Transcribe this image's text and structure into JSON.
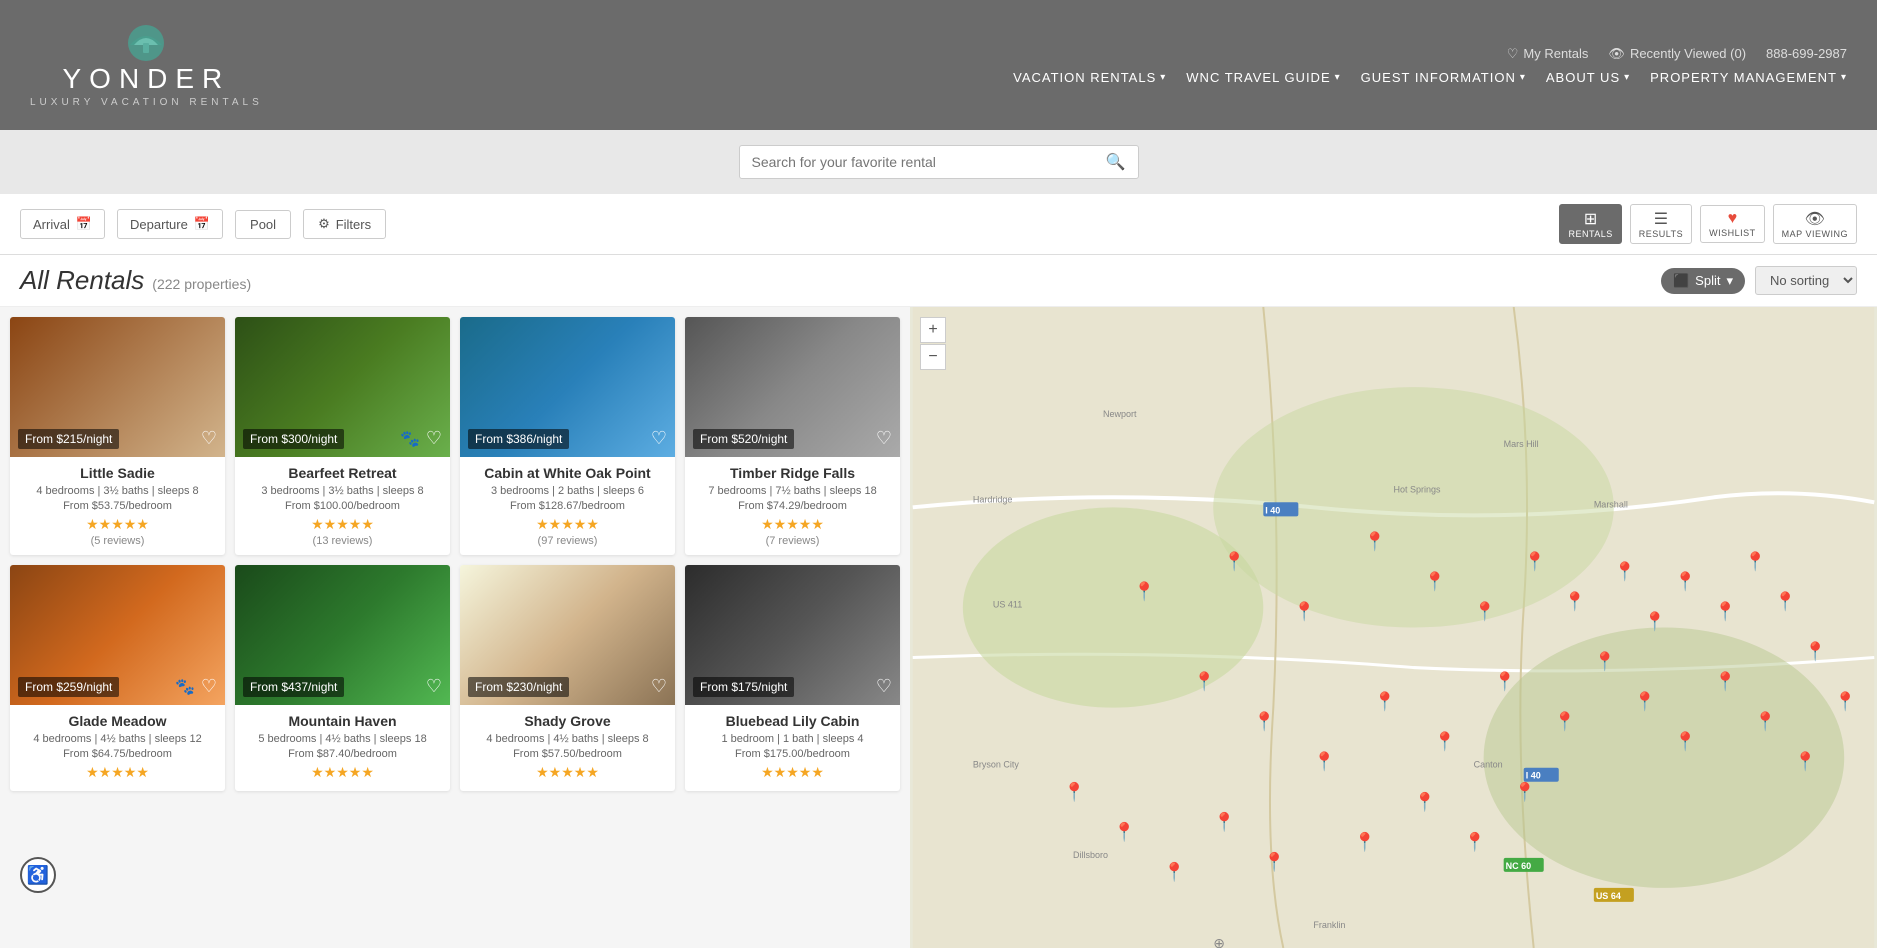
{
  "header": {
    "logo_text": "YONDER",
    "logo_sub": "LUXURY VACATION RENTALS",
    "top_links": {
      "my_rentals": "My Rentals",
      "recently_viewed": "Recently Viewed (0)",
      "phone": "888-699-2987"
    },
    "nav": [
      {
        "label": "VACATION RENTALS",
        "has_dropdown": true
      },
      {
        "label": "WNC TRAVEL GUIDE",
        "has_dropdown": true
      },
      {
        "label": "GUEST INFORMATION",
        "has_dropdown": true
      },
      {
        "label": "ABOUT US",
        "has_dropdown": true
      },
      {
        "label": "PROPERTY MANAGEMENT",
        "has_dropdown": true
      }
    ]
  },
  "search": {
    "placeholder": "Search for your favorite rental"
  },
  "filters": {
    "arrival_label": "Arrival",
    "departure_label": "Departure",
    "pool_label": "Pool",
    "filters_label": "Filters"
  },
  "page": {
    "title": "All Rentals",
    "count": "(222 properties)",
    "split_label": "Split",
    "sort_label": "No sorting"
  },
  "view_buttons": [
    {
      "id": "rentals",
      "icon": "⊞",
      "label": "RENTALS",
      "active": true
    },
    {
      "id": "results",
      "icon": "☰",
      "label": "RESULTS",
      "active": false
    },
    {
      "id": "wishlist",
      "icon": "♥",
      "label": "WISHLIST",
      "active": false
    },
    {
      "id": "map-view",
      "icon": "👁",
      "label": "MAP VIEWING",
      "active": false
    }
  ],
  "listings": [
    {
      "id": "little-sadie",
      "name": "Little Sadie",
      "price_badge": "From $215/night",
      "details": "4 bedrooms  |  3½ baths  |  sleeps 8",
      "price_per": "From $53.75/bedroom",
      "stars": 5,
      "reviews": "(5 reviews)",
      "pet_friendly": false,
      "photo_class": "photo-1"
    },
    {
      "id": "bearfeet-retreat",
      "name": "Bearfeet Retreat",
      "price_badge": "From $300/night",
      "details": "3 bedrooms  |  3½ baths  |  sleeps 8",
      "price_per": "From $100.00/bedroom",
      "stars": 5,
      "reviews": "(13 reviews)",
      "pet_friendly": true,
      "photo_class": "photo-2"
    },
    {
      "id": "cabin-white-oak",
      "name": "Cabin at White Oak Point",
      "price_badge": "From $386/night",
      "details": "3 bedrooms  |  2 baths  |  sleeps 6",
      "price_per": "From $128.67/bedroom",
      "stars": 5,
      "reviews": "(97 reviews)",
      "pet_friendly": false,
      "photo_class": "photo-3"
    },
    {
      "id": "timber-ridge-falls",
      "name": "Timber Ridge Falls",
      "price_badge": "From $520/night",
      "details": "7 bedrooms  |  7½ baths  |  sleeps 18",
      "price_per": "From $74.29/bedroom",
      "stars": 5,
      "reviews": "(7 reviews)",
      "pet_friendly": false,
      "photo_class": "photo-4"
    },
    {
      "id": "glade-meadow",
      "name": "Glade Meadow",
      "price_badge": "From $259/night",
      "details": "4 bedrooms  |  4½ baths  |  sleeps 12",
      "price_per": "From $64.75/bedroom",
      "stars": 5,
      "reviews": "",
      "pet_friendly": true,
      "photo_class": "photo-5"
    },
    {
      "id": "mountain-haven",
      "name": "Mountain Haven",
      "price_badge": "From $437/night",
      "details": "5 bedrooms  |  4½ baths  |  sleeps 18",
      "price_per": "From $87.40/bedroom",
      "stars": 5,
      "reviews": "",
      "pet_friendly": false,
      "photo_class": "photo-6"
    },
    {
      "id": "shady-grove",
      "name": "Shady Grove",
      "price_badge": "From $230/night",
      "details": "4 bedrooms  |  4½ baths  |  sleeps 8",
      "price_per": "From $57.50/bedroom",
      "stars": 5,
      "reviews": "",
      "pet_friendly": false,
      "photo_class": "photo-7"
    },
    {
      "id": "bluebead-lily",
      "name": "Bluebead Lily Cabin",
      "price_badge": "From $175/night",
      "details": "1 bedroom  |  1 bath  |  sleeps 4",
      "price_per": "From $175.00/bedroom",
      "stars": 5,
      "reviews": "",
      "pet_friendly": false,
      "photo_class": "photo-8"
    }
  ],
  "map": {
    "zoom_in": "+",
    "zoom_out": "−"
  },
  "accessibility": {
    "label": "♿"
  }
}
